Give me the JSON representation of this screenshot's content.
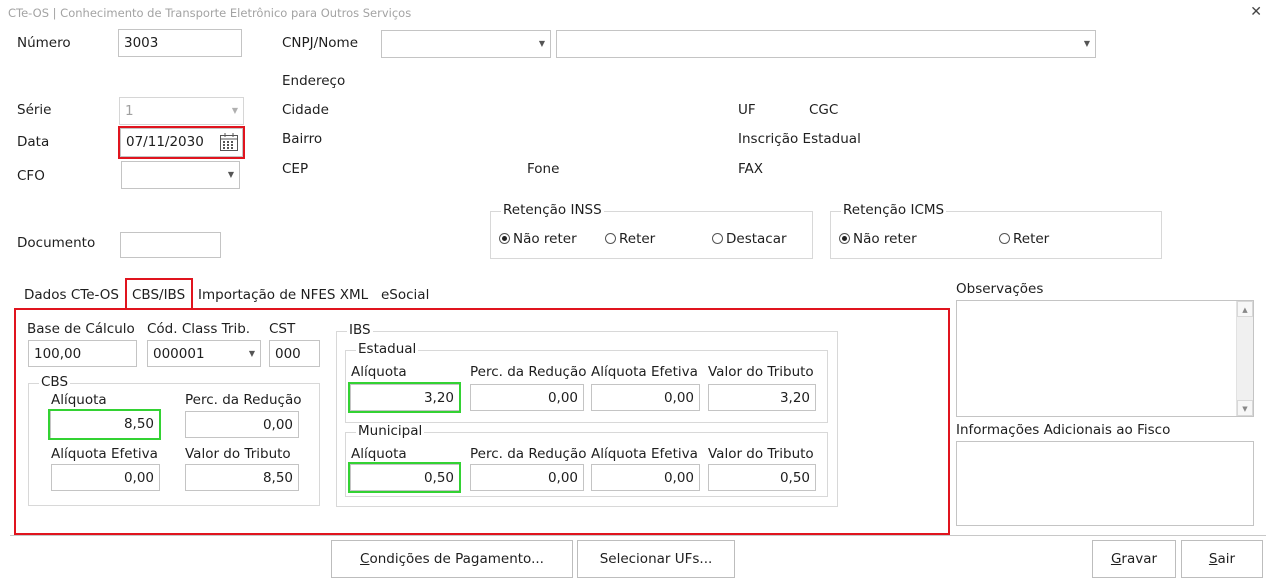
{
  "window": {
    "title": "CTe-OS | Conhecimento de Transporte Eletrônico para Outros Serviços"
  },
  "left": {
    "numero_label": "Número",
    "numero_value": "3003",
    "serie_label": "Série",
    "serie_value": "1",
    "data_label": "Data",
    "data_value": "07/11/2030",
    "cfo_label": "CFO",
    "cfo_value": "",
    "documento_label": "Documento",
    "documento_value": ""
  },
  "cliente": {
    "cnpj_label": "CNPJ/Nome",
    "endereco_label": "Endereço",
    "cidade_label": "Cidade",
    "bairro_label": "Bairro",
    "cep_label": "CEP",
    "fone_label": "Fone",
    "uf_label": "UF",
    "cgc_label": "CGC",
    "ie_label": "Inscrição Estadual",
    "fax_label": "FAX"
  },
  "retencao_inss": {
    "legend": "Retenção INSS",
    "options": [
      "Não reter",
      "Reter",
      "Destacar"
    ],
    "selected": "Não reter"
  },
  "retencao_icms": {
    "legend": "Retenção ICMS",
    "options": [
      "Não reter",
      "Reter"
    ],
    "selected": "Não reter"
  },
  "tabs": [
    "Dados CTe-OS",
    "CBS/IBS",
    "Importação de NFES XML",
    "eSocial"
  ],
  "active_tab": "CBS/IBS",
  "cbs_ibs": {
    "base_label": "Base de Cálculo",
    "base_value": "100,00",
    "class_label": "Cód. Class Trib.",
    "class_value": "000001",
    "cst_label": "CST",
    "cst_value": "000",
    "cbs": {
      "legend": "CBS",
      "aliquota_label": "Alíquota",
      "aliquota_value": "8,50",
      "reducao_label": "Perc. da Redução",
      "reducao_value": "0,00",
      "efetiva_label": "Alíquota Efetiva",
      "efetiva_value": "0,00",
      "tributo_label": "Valor do Tributo",
      "tributo_value": "8,50"
    },
    "ibs": {
      "legend": "IBS",
      "estadual": {
        "legend": "Estadual",
        "aliquota_label": "Alíquota",
        "aliquota_value": "3,20",
        "reducao_label": "Perc. da Redução",
        "reducao_value": "0,00",
        "efetiva_label": "Alíquota Efetiva",
        "efetiva_value": "0,00",
        "tributo_label": "Valor do Tributo",
        "tributo_value": "3,20"
      },
      "municipal": {
        "legend": "Municipal",
        "aliquota_label": "Alíquota",
        "aliquota_value": "0,50",
        "reducao_label": "Perc. da Redução",
        "reducao_value": "0,00",
        "efetiva_label": "Alíquota Efetiva",
        "efetiva_value": "0,00",
        "tributo_label": "Valor do Tributo",
        "tributo_value": "0,50"
      }
    }
  },
  "observacoes_label": "Observações",
  "info_fisco_label": "Informações Adicionais ao Fisco",
  "buttons": {
    "condicoes_key": "C",
    "condicoes_rest": "ondições de Pagamento...",
    "selecionar": "Selecionar UFs...",
    "gravar_key": "G",
    "gravar_rest": "ravar",
    "sair_key": "S",
    "sair_rest": "air"
  },
  "colors": {
    "highlight_red": "#e0141e",
    "highlight_green": "#33d233"
  }
}
